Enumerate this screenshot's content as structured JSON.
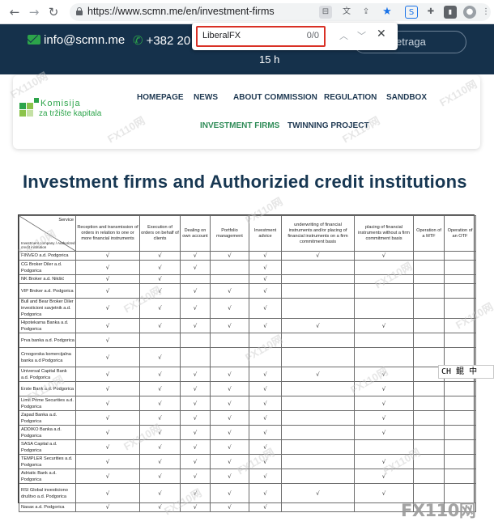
{
  "browser": {
    "url": "https://www.scmn.me/en/investment-firms",
    "find": {
      "query": "LiberalFX",
      "count": "0/0"
    }
  },
  "topbar": {
    "email": "info@scmn.me",
    "phone": "+382 20 4",
    "hours": "15 h",
    "search_placeholder": "etraga"
  },
  "logo": {
    "line1": "Komisija",
    "line2": "za tržište kapitala"
  },
  "menu": {
    "row1": [
      "HOMEPAGE",
      "NEWS",
      "ABOUT COMMISSION",
      "REGULATION",
      "SANDBOX"
    ],
    "row2": [
      "INVESTMENT FIRMS",
      "TWINNING PROJECT"
    ],
    "active": "INVESTMENT FIRMS"
  },
  "page_title": "Investment firms and Authorizied credit institutions",
  "table": {
    "corner_top": "Service",
    "corner_bottom": "Investment company / Authorized credit institution",
    "headers": [
      "Reception and transmission of orders in relation to one or more financial instruments",
      "Execution of orders on behalf of clients",
      "Dealing on own account",
      "Portfolio management",
      "Investment advice",
      "underwriting of financial instruments and/or placing of financial instruments on a firm commitment basis",
      "placing of financial instruments without a firm commitment basis",
      "Operation of a MTF",
      "Operation of an OTF"
    ],
    "check": "√",
    "rows": [
      {
        "name": "FINVEO a.d. Podgorica",
        "marks": [
          1,
          1,
          1,
          1,
          1,
          1,
          1,
          0,
          0
        ]
      },
      {
        "name": "CG Broker Diler a.d. Podgorica",
        "marks": [
          1,
          1,
          1,
          0,
          1,
          0,
          0,
          0,
          0
        ]
      },
      {
        "name": "NK Broker a.d. Nikšić",
        "marks": [
          1,
          1,
          0,
          0,
          1,
          0,
          0,
          0,
          0
        ]
      },
      {
        "name": "VIP Broker a.d. Podgorica",
        "marks": [
          1,
          1,
          1,
          1,
          1,
          0,
          0,
          0,
          0
        ]
      },
      {
        "name": "Bull and Bear Broker Diler investicioni savjetnik a.d. Podgorica",
        "marks": [
          1,
          1,
          1,
          1,
          1,
          0,
          0,
          0,
          0
        ]
      },
      {
        "name": "Hipotekarna Banka a.d. Podgorica",
        "marks": [
          1,
          1,
          1,
          1,
          1,
          1,
          1,
          0,
          0
        ]
      },
      {
        "name": "Prva banka a.d. Podgorica",
        "marks": [
          1,
          0,
          0,
          0,
          0,
          0,
          0,
          0,
          0
        ]
      },
      {
        "name": "Crnogorska komercijalna banka a.d Podgorica",
        "marks": [
          1,
          1,
          0,
          0,
          0,
          0,
          0,
          0,
          0
        ]
      },
      {
        "name": "Universal Capital Bank a.d. Podgorica",
        "marks": [
          1,
          1,
          1,
          1,
          1,
          1,
          1,
          0,
          0
        ]
      },
      {
        "name": "Erste Bank a.d. Podgorica",
        "marks": [
          1,
          1,
          1,
          1,
          1,
          0,
          1,
          0,
          0
        ]
      },
      {
        "name": "Limit Prime Securities a.d. Podgorica",
        "marks": [
          1,
          1,
          1,
          1,
          1,
          0,
          1,
          0,
          0
        ]
      },
      {
        "name": "Zapad Banka a.d. Podgorica",
        "marks": [
          1,
          1,
          1,
          1,
          1,
          0,
          1,
          0,
          0
        ]
      },
      {
        "name": "ADDIKO Banka a.d. Podgorica",
        "marks": [
          1,
          1,
          1,
          1,
          1,
          0,
          1,
          0,
          0
        ]
      },
      {
        "name": "SASA Capital a.d. Podgorica",
        "marks": [
          1,
          1,
          1,
          1,
          1,
          0,
          0,
          0,
          0
        ]
      },
      {
        "name": "TEMPLER Securities a.d. Podgorica",
        "marks": [
          1,
          1,
          1,
          1,
          1,
          0,
          1,
          0,
          0
        ]
      },
      {
        "name": "Adriatic Bank a.d. Podgorica",
        "marks": [
          1,
          1,
          1,
          1,
          1,
          0,
          1,
          0,
          0
        ]
      },
      {
        "name": "RSI Global investiciono društvo a.d. Podgorica",
        "marks": [
          1,
          1,
          1,
          1,
          1,
          1,
          1,
          0,
          0
        ]
      },
      {
        "name": "Nasax a.d. Podgorica",
        "marks": [
          1,
          1,
          1,
          1,
          1,
          0,
          0,
          0,
          0
        ]
      }
    ]
  },
  "ime": {
    "label": "CH 鲲 中"
  },
  "watermark": {
    "text": "FX110网",
    "corner": "FX110网"
  }
}
